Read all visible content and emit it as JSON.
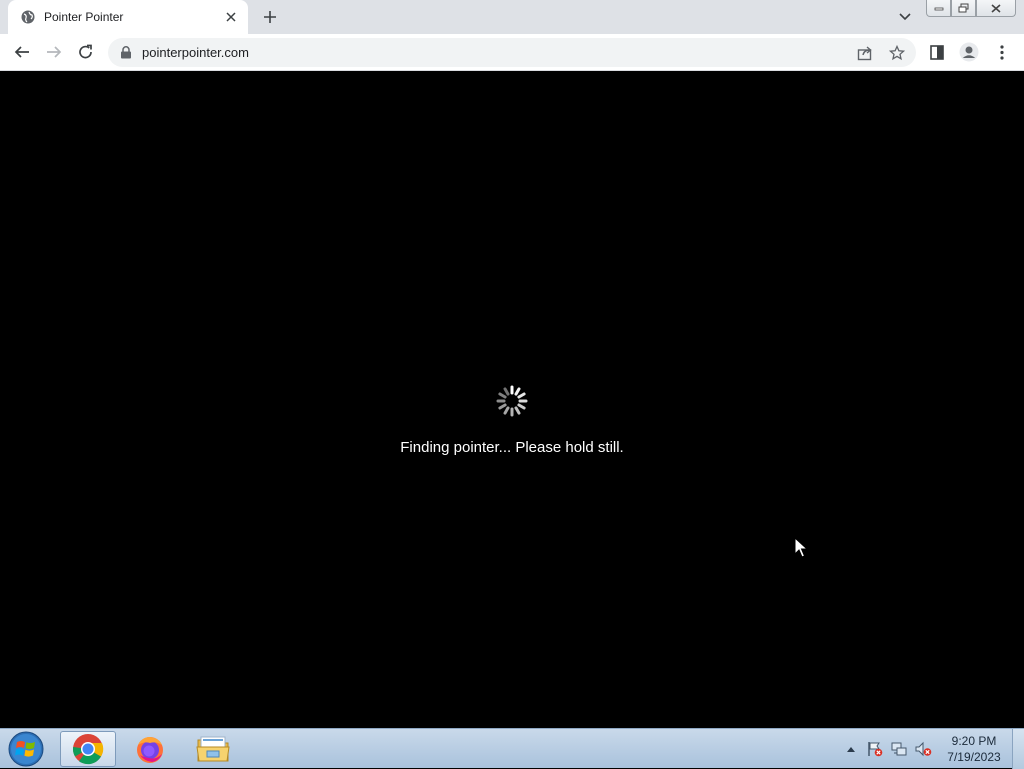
{
  "browser": {
    "tab": {
      "title": "Pointer Pointer",
      "favicon": "globe-icon"
    },
    "new_tab": "plus-icon",
    "address": {
      "url": "pointerpointer.com",
      "lock": "lock-icon"
    },
    "toolbar_icons": [
      "back-icon",
      "forward-icon",
      "reload-icon",
      "share-icon",
      "star-icon",
      "side-panel-icon",
      "profile-icon",
      "menu-icon"
    ]
  },
  "page": {
    "loading_text": "Finding pointer... Please hold still.",
    "background": "#000000",
    "text_color": "#ffffff"
  },
  "taskbar": {
    "apps": [
      "chrome-icon",
      "firefox-icon",
      "file-explorer-icon"
    ],
    "clock": {
      "time": "9:20 PM",
      "date": "7/19/2023"
    }
  }
}
